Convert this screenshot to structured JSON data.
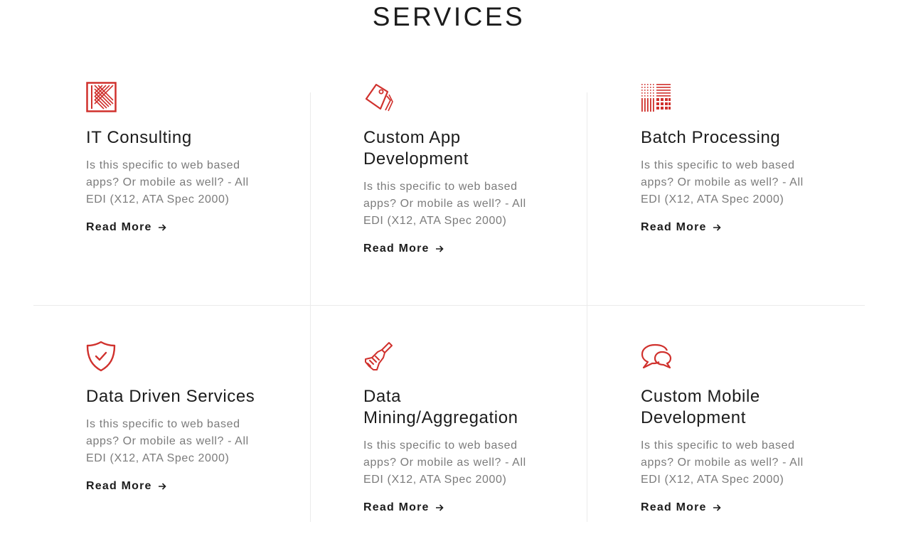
{
  "page": {
    "title": "SERVICES"
  },
  "theme": {
    "accent": "#d0312d",
    "divider": "#ebebeb"
  },
  "services": [
    {
      "icon": "diagonal-lines-icon",
      "title": "IT Consulting",
      "description": "Is this specific to web based apps? Or mobile as well? - All EDI (X12, ATA Spec 2000)",
      "link_label": "Read More"
    },
    {
      "icon": "price-tag-icon",
      "title": "Custom App Development",
      "description": "Is this specific to web based apps? Or mobile as well? - All EDI (X12, ATA Spec 2000)",
      "link_label": "Read More"
    },
    {
      "icon": "grid-pattern-icon",
      "title": "Batch Processing",
      "description": "Is this specific to web based apps? Or mobile as well? - All EDI (X12, ATA Spec 2000)",
      "link_label": "Read More"
    },
    {
      "icon": "shield-check-icon",
      "title": "Data Driven Services",
      "description": "Is this specific to web based apps? Or mobile as well? - All EDI (X12, ATA Spec 2000)",
      "link_label": "Read More"
    },
    {
      "icon": "broom-icon",
      "title": "Data Mining/Aggregation",
      "description": "Is this specific to web based apps? Or mobile as well? - All EDI (X12, ATA Spec 2000)",
      "link_label": "Read More"
    },
    {
      "icon": "chat-bubbles-icon",
      "title": "Custom Mobile Development",
      "description": "Is this specific to web based apps? Or mobile as well? - All EDI (X12, ATA Spec 2000)",
      "link_label": "Read More"
    }
  ]
}
